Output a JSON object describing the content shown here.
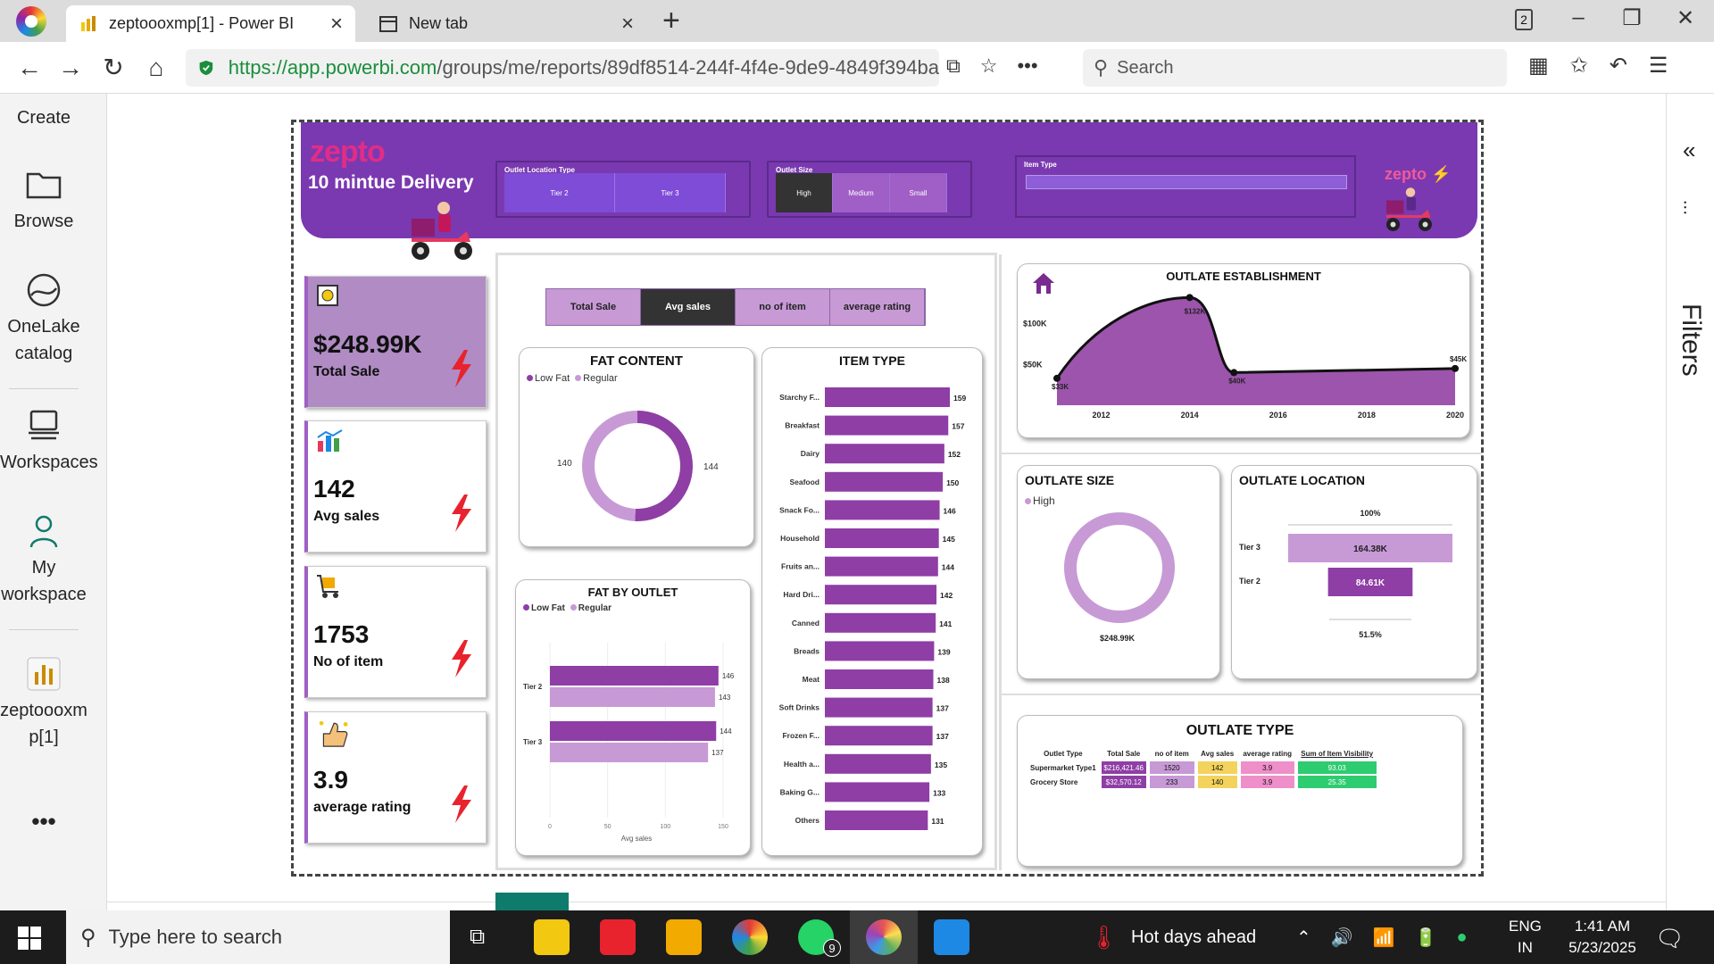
{
  "browser": {
    "active_tab": "zeptoooxmp[1] - Power BI",
    "inactive_tab": "New tab",
    "tab_count": "2",
    "url_host": "https://app.powerbi.com",
    "url_path": "/groups/me/reports/89df8514-244f-4f4e-9de9-4849f394ba",
    "search_placeholder": "Search"
  },
  "rail": {
    "items": [
      {
        "label": "Create"
      },
      {
        "label": "Browse"
      },
      {
        "label": "OneLake catalog"
      },
      {
        "label": "Workspaces"
      },
      {
        "label": "My workspace"
      },
      {
        "label": "zeptoooxm p[1]"
      }
    ],
    "more": "•••"
  },
  "filters": {
    "label": "Filters",
    "collapse": "«"
  },
  "banner": {
    "logo": "zepto",
    "tagline": "10 mintue Delivery",
    "logo_right": "zepto",
    "slicers": [
      {
        "title": "Outlet Location Type",
        "options": [
          "Tier 2",
          "Tier 3"
        ]
      },
      {
        "title": "Outlet Size",
        "options": [
          "High",
          "Medium",
          "Small"
        ],
        "selected": "High"
      },
      {
        "title": "Item Type",
        "options": []
      }
    ]
  },
  "kpis": [
    {
      "value": "$248.99K",
      "label": "Total Sale"
    },
    {
      "value": "142",
      "label": "Avg sales"
    },
    {
      "value": "1753",
      "label": "No of item"
    },
    {
      "value": "3.9",
      "label": "average rating"
    }
  ],
  "measure_buttons": [
    "Total Sale",
    "Avg sales",
    "no of item",
    "average rating"
  ],
  "measure_selected": "Avg sales",
  "colors": {
    "primary": "#8e3ea5",
    "light": "#c79ad6",
    "banner": "#7a39b0",
    "bolt": "#e8232e"
  },
  "fat_content": {
    "title": "FAT CONTENT",
    "legend": [
      "Low Fat",
      "Regular"
    ],
    "chart_data": {
      "type": "pie",
      "categories": [
        "Low Fat",
        "Regular"
      ],
      "values": [
        144,
        140
      ]
    }
  },
  "item_type": {
    "title": "ITEM TYPE",
    "chart_data": {
      "type": "bar",
      "categories": [
        "Starchy F...",
        "Breakfast",
        "Dairy",
        "Seafood",
        "Snack Fo...",
        "Household",
        "Fruits an...",
        "Hard Dri...",
        "Canned",
        "Breads",
        "Meat",
        "Soft Drinks",
        "Frozen F...",
        "Health a...",
        "Baking G...",
        "Others"
      ],
      "values": [
        159,
        157,
        152,
        150,
        146,
        145,
        144,
        142,
        141,
        139,
        138,
        137,
        137,
        135,
        133,
        131
      ]
    }
  },
  "fat_by_outlet": {
    "title": "FAT BY OUTLET",
    "legend": [
      "Low Fat",
      "Regular"
    ],
    "xlabel": "Avg sales",
    "ticks": [
      "0",
      "50",
      "100",
      "150"
    ],
    "chart_data": {
      "type": "bar",
      "categories": [
        "Tier 2",
        "Tier 3"
      ],
      "series": [
        {
          "name": "Low Fat",
          "values": [
            146,
            144
          ]
        },
        {
          "name": "Regular",
          "values": [
            143,
            137
          ]
        }
      ],
      "xlabel": "Avg sales",
      "xlim": [
        0,
        150
      ]
    }
  },
  "establishment": {
    "title": "OUTLATE ESTABLISHMENT",
    "y_ticks": [
      "$100K",
      "$50K"
    ],
    "x_ticks": [
      "2012",
      "2014",
      "2016",
      "2018",
      "2020"
    ],
    "point_labels": [
      "$33K",
      "$132K",
      "$40K",
      "$45K"
    ],
    "chart_data": {
      "type": "area",
      "x": [
        2011,
        2014,
        2015,
        2020
      ],
      "values": [
        33,
        132,
        40,
        45
      ],
      "ylim": [
        0,
        140
      ]
    }
  },
  "outlet_size": {
    "title": "OUTLATE SIZE",
    "legend": [
      "High"
    ],
    "value_label": "$248.99K",
    "chart_data": {
      "type": "pie",
      "categories": [
        "High"
      ],
      "values": [
        248.99
      ]
    }
  },
  "outlet_location": {
    "title": "OUTLATE LOCATION",
    "top_pct": "100%",
    "bottom_pct": "51.5%",
    "labels": [
      "164.38K",
      "84.61K"
    ],
    "chart_data": {
      "type": "bar",
      "categories": [
        "Tier 3",
        "Tier 2"
      ],
      "values": [
        164.38,
        84.61
      ]
    }
  },
  "outlet_type": {
    "title": "OUTLATE TYPE",
    "columns": [
      "Outlet Type",
      "Total Sale",
      "no of item",
      "Avg sales",
      "average rating",
      "Sum of Item Visibility"
    ],
    "rows": [
      [
        "Supermarket Type1",
        "$216,421.46",
        "1520",
        "142",
        "3.9",
        "93.03"
      ],
      [
        "Grocery Store",
        "$32,570.12",
        "233",
        "140",
        "3.9",
        "25.35"
      ]
    ]
  },
  "taskbar": {
    "search": "Type here to search",
    "weather": "Hot days ahead",
    "lang1": "ENG",
    "lang2": "IN",
    "time": "1:41 AM",
    "date": "5/23/2025",
    "whatsapp_badge": "9"
  }
}
